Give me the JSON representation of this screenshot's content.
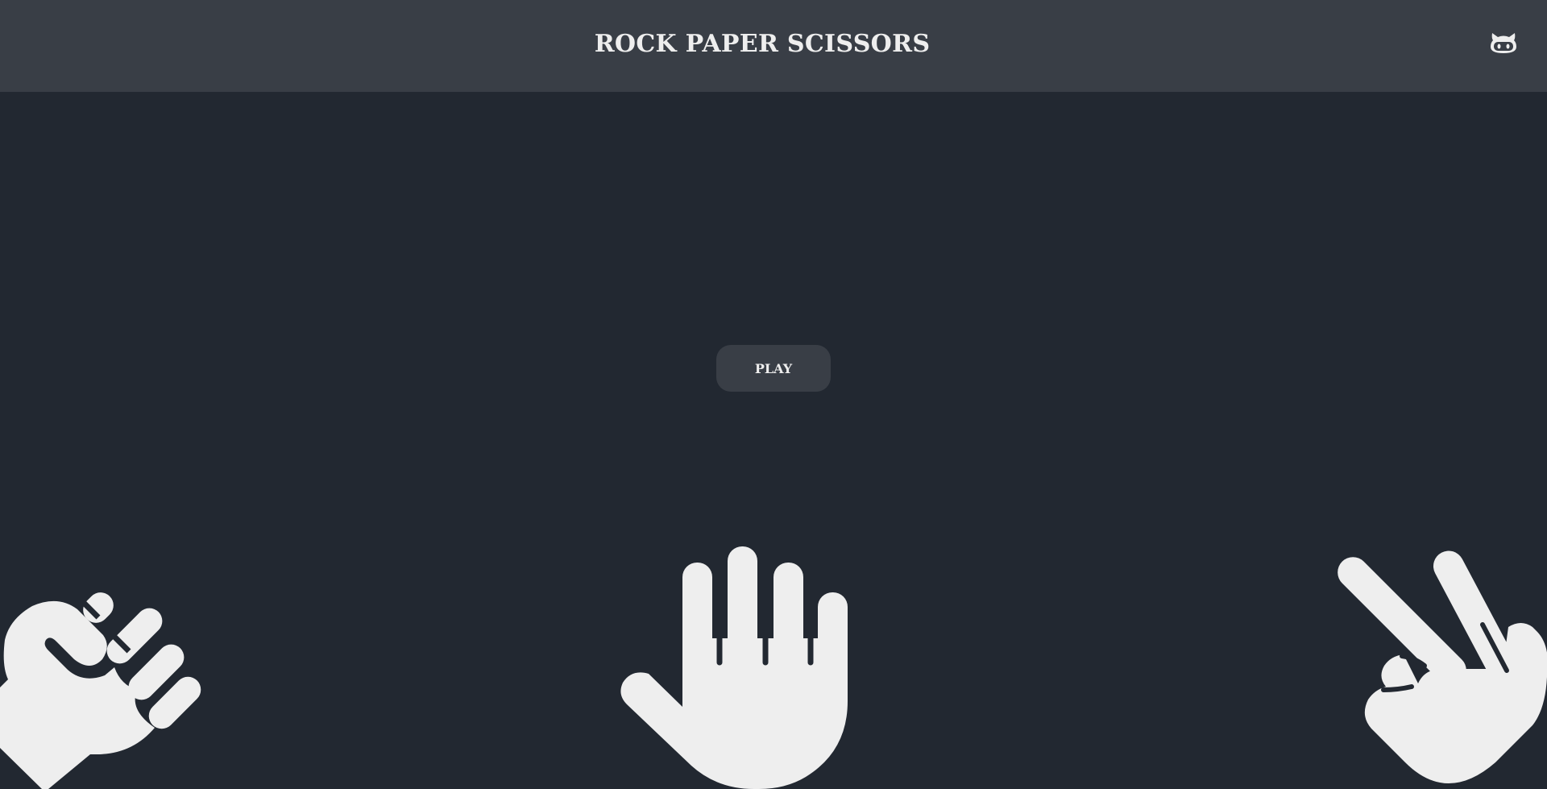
{
  "header": {
    "title": "ROCK PAPER SCISSORS",
    "github_icon": "github-octocat-icon"
  },
  "main": {
    "play_label": "PLAY",
    "hands": [
      {
        "name": "rock",
        "icon": "rock-fist-icon"
      },
      {
        "name": "paper",
        "icon": "paper-open-hand-icon"
      },
      {
        "name": "scissors",
        "icon": "scissors-hand-icon"
      }
    ]
  },
  "colors": {
    "background": "#222831",
    "header": "#393e46",
    "text": "#eeeeee",
    "button": "#393e46"
  }
}
